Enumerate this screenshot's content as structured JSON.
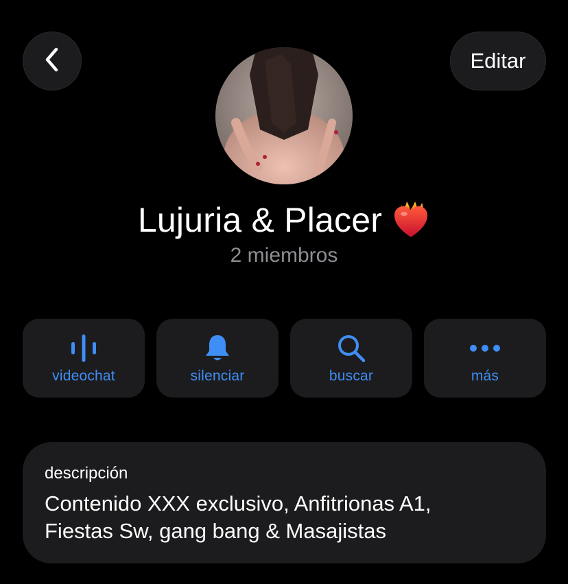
{
  "header": {
    "back_icon": "chevron-left-icon",
    "edit_label": "Editar"
  },
  "profile": {
    "name": "Lujuria & Placer",
    "emoji_icon": "heart-on-fire-icon",
    "members": "2 miembros"
  },
  "actions": [
    {
      "label": "videochat",
      "icon": "audio-waveform-icon"
    },
    {
      "label": "silenciar",
      "icon": "bell-icon"
    },
    {
      "label": "buscar",
      "icon": "search-icon"
    },
    {
      "label": "más",
      "icon": "more-icon"
    }
  ],
  "description": {
    "label": "descripción",
    "line1": "Contenido XXX exclusivo, Anfitrionas A1,",
    "line2": "Fiestas Sw, gang bang & Masajistas"
  },
  "colors": {
    "background": "#000000",
    "card": "#1c1c1e",
    "accent": "#3f8ef5",
    "secondary_text": "#8e8e93"
  }
}
